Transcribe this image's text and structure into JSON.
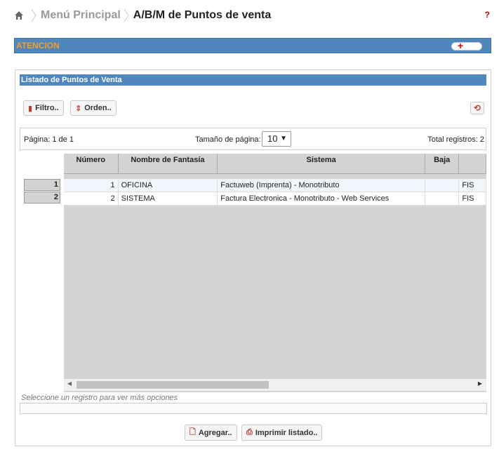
{
  "breadcrumb": {
    "home_icon": "home-icon",
    "menu_label": "Menú Principal",
    "current_label": "A/B/M de Puntos de venta",
    "help_label": "?"
  },
  "atencion": {
    "title": "ATENCION",
    "expand_label": "+"
  },
  "panel": {
    "title": "Listado de Puntos de Venta",
    "filter_label": "Filtro..",
    "order_label": "Orden..",
    "refresh_icon": "refresh-icon"
  },
  "pager": {
    "page_label": "Página: 1 de 1",
    "page_size_label": "Tamaño de página:",
    "page_size_value": "10",
    "total_label": "Total registros: 2"
  },
  "table": {
    "columns": [
      "Número",
      "Nombre de Fantasía",
      "Sistema",
      "Baja",
      ""
    ],
    "rows": [
      {
        "rownum": "1",
        "numero": "1",
        "nombre": "OFICINA",
        "sistema": "Factuweb (Imprenta) - Monotributo",
        "baja": "",
        "extra": "FIS"
      },
      {
        "rownum": "2",
        "numero": "2",
        "nombre": "SISTEMA",
        "sistema": "Factura Electronica - Monotributo - Web Services",
        "baja": "",
        "extra": "FIS"
      }
    ]
  },
  "footer": {
    "hint": "Seleccione un registro para ver más opciones",
    "add_label": "Agregar..",
    "print_label": "Imprimir listado.."
  },
  "colors": {
    "accent_bar": "#4f87bd",
    "atencion_text": "#f39c2b",
    "icon_red": "#c0392b"
  }
}
